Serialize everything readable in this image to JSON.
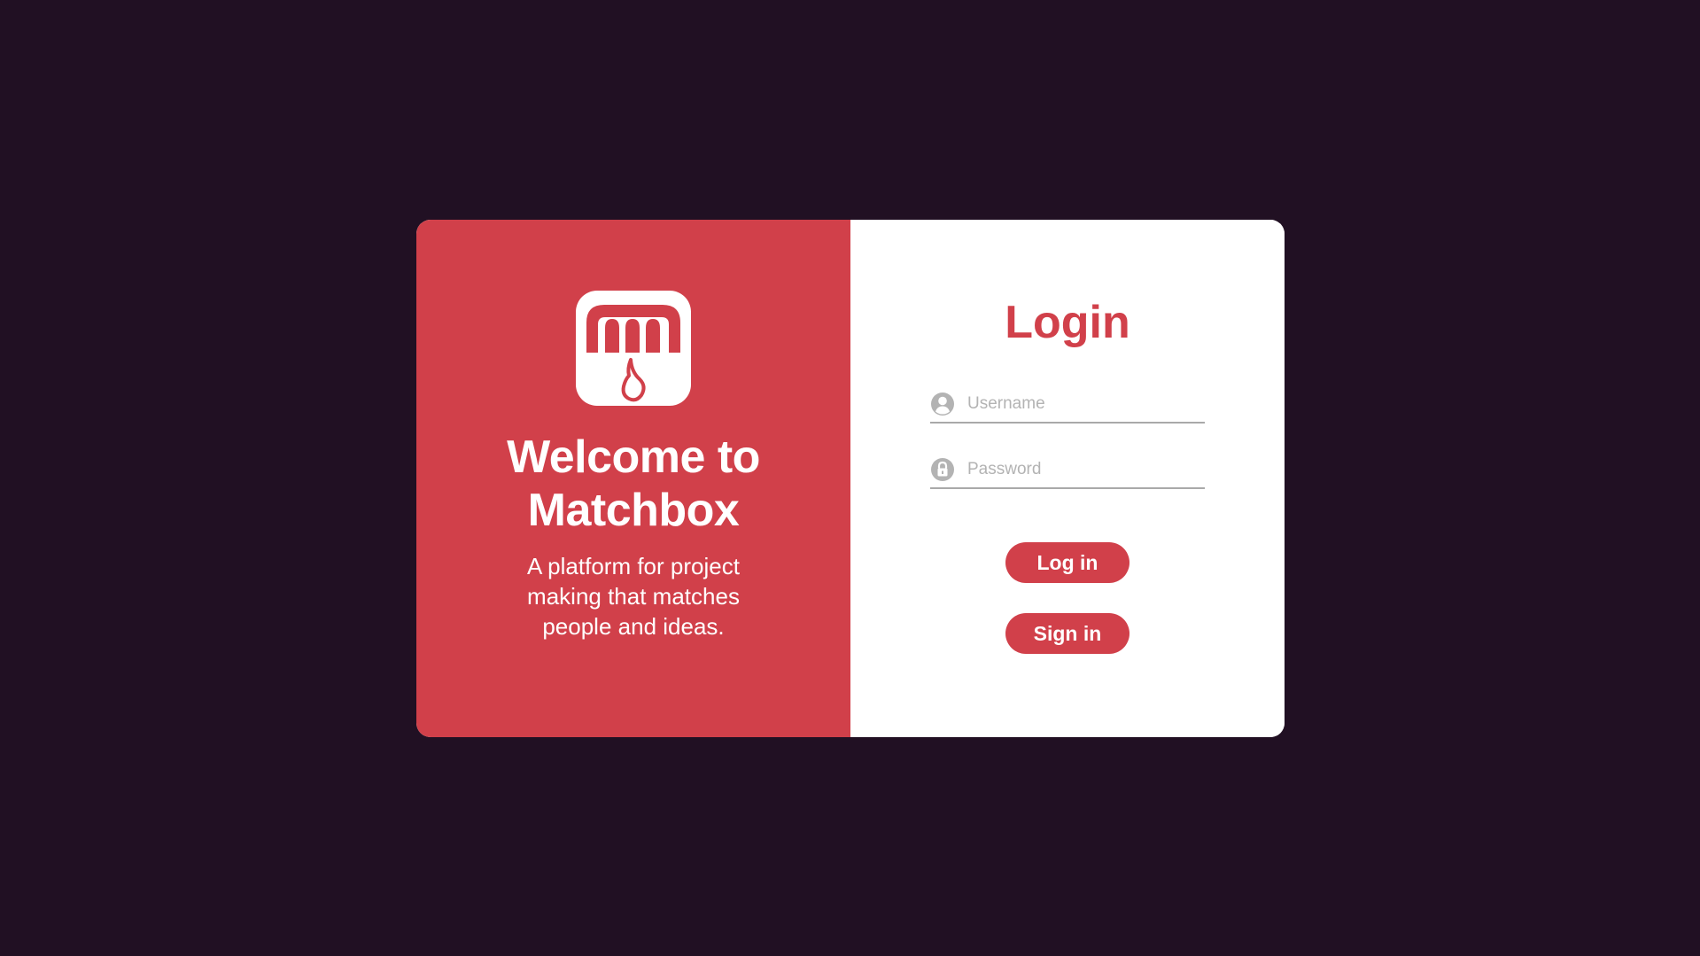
{
  "brand": {
    "logo_icon": "matchbox-logo-icon",
    "accent_color": "#d1404a",
    "background_color": "#211023"
  },
  "welcome": {
    "title_line1": "Welcome to",
    "title_line2": "Matchbox",
    "tagline_line1": "A platform for project",
    "tagline_line2": "making that matches",
    "tagline_line3": "people and ideas."
  },
  "login_form": {
    "heading": "Login",
    "username": {
      "icon": "user-icon",
      "placeholder": "Username",
      "value": ""
    },
    "password": {
      "icon": "lock-icon",
      "placeholder": "Password",
      "value": ""
    },
    "login_button_label": "Log in",
    "signin_button_label": "Sign in"
  }
}
